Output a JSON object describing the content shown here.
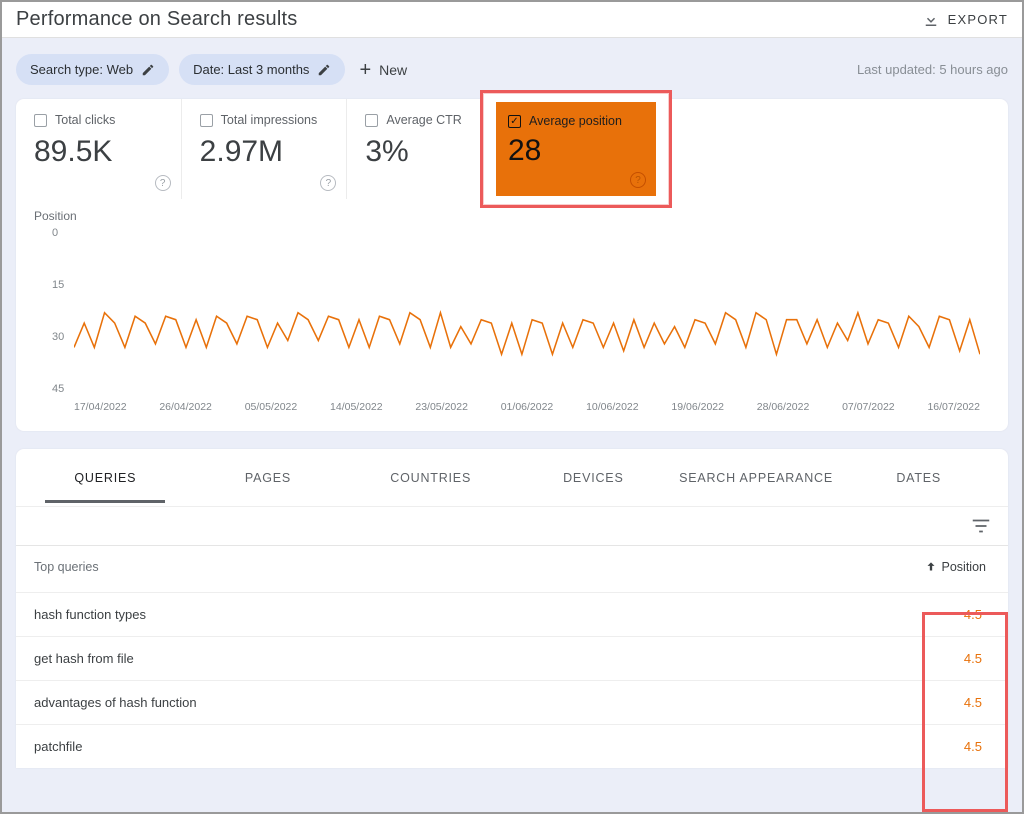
{
  "header": {
    "title": "Performance on Search results",
    "export_label": "EXPORT"
  },
  "filters": {
    "search_type": "Search type: Web",
    "date": "Date: Last 3 months",
    "new_label": "New",
    "last_updated": "Last updated: 5 hours ago"
  },
  "metrics": {
    "clicks": {
      "label": "Total clicks",
      "value": "89.5K"
    },
    "impressions": {
      "label": "Total impressions",
      "value": "2.97M"
    },
    "ctr": {
      "label": "Average CTR",
      "value": "3%"
    },
    "position": {
      "label": "Average position",
      "value": "28"
    }
  },
  "chart_data": {
    "type": "line",
    "title": "",
    "ylabel": "Position",
    "xlabel": "",
    "ylim": [
      0,
      45
    ],
    "yticks": [
      0,
      15,
      30,
      45
    ],
    "categories": [
      "17/04/2022",
      "26/04/2022",
      "05/05/2022",
      "14/05/2022",
      "23/05/2022",
      "01/06/2022",
      "10/06/2022",
      "19/06/2022",
      "28/06/2022",
      "07/07/2022",
      "16/07/2022"
    ],
    "series": [
      {
        "name": "Average position",
        "color": "#e8710a",
        "values": [
          33,
          26,
          33,
          23,
          26,
          33,
          24,
          26,
          32,
          24,
          25,
          33,
          25,
          33,
          24,
          26,
          32,
          24,
          25,
          33,
          26,
          31,
          23,
          25,
          31,
          24,
          25,
          33,
          25,
          33,
          24,
          25,
          32,
          23,
          25,
          33,
          23,
          33,
          27,
          32,
          25,
          26,
          35,
          26,
          35,
          25,
          26,
          35,
          26,
          33,
          25,
          26,
          33,
          26,
          34,
          25,
          33,
          26,
          32,
          27,
          33,
          25,
          26,
          32,
          23,
          25,
          33,
          23,
          25,
          35,
          25,
          25,
          32,
          25,
          33,
          26,
          31,
          23,
          32,
          25,
          26,
          33,
          24,
          27,
          33,
          24,
          25,
          34,
          25,
          35
        ]
      }
    ]
  },
  "tabs": [
    "QUERIES",
    "PAGES",
    "COUNTRIES",
    "DEVICES",
    "SEARCH APPEARANCE",
    "DATES"
  ],
  "table": {
    "header_query": "Top queries",
    "header_position": "Position",
    "rows": [
      {
        "query": "hash function types",
        "position": "4.5"
      },
      {
        "query": "get hash from file",
        "position": "4.5"
      },
      {
        "query": "advantages of hash function",
        "position": "4.5"
      },
      {
        "query": "patchfile",
        "position": "4.5"
      }
    ]
  }
}
